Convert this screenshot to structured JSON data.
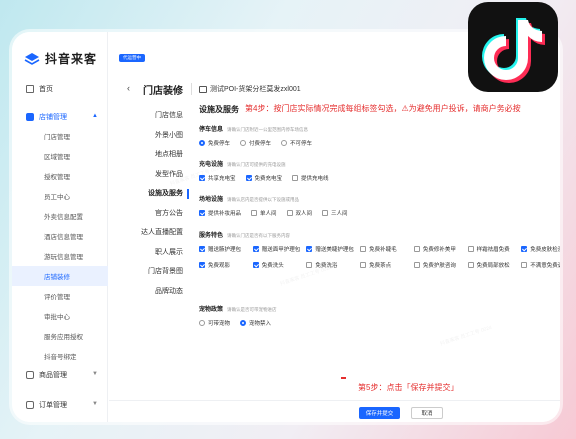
{
  "brand": {
    "name": "抖音来客"
  },
  "sidebar": {
    "home": "首页",
    "store_group": "店铺管理",
    "sub_items": [
      "门店管理",
      "区域管理",
      "授权管理",
      "员工中心",
      "外卖信息配置",
      "酒店信息管理",
      "游玩信息管理",
      "店铺装修",
      "评价管理",
      "审批中心",
      "服务应用授权",
      "抖音号绑定"
    ],
    "active_sub": "店铺装修",
    "product": "商品管理",
    "order": "订单管理"
  },
  "header": {
    "tag": "代运营中",
    "back_icon": "‹",
    "title": "门店装修",
    "store_name": "测试POI-货架分栏莫发zxl001"
  },
  "left_menu": {
    "items": [
      "门店信息",
      "外景小图",
      "地点相册",
      "发型作品",
      "设施及服务",
      "官方公告",
      "达人直播配置",
      "职人展示",
      "门店背景图",
      "品牌动态"
    ],
    "active": "设施及服务"
  },
  "content": {
    "section_title": "设施及服务",
    "step4": "第4步：按门店实际情况完成每组标签勾选，⚠为避免用户投诉，请商户务必按",
    "parking": {
      "label": "停车信息",
      "hint": "请确认门店附近一公里范围内停车场信息",
      "options": [
        "免费停车",
        "付费停车",
        "不可停车"
      ]
    },
    "charging": {
      "label": "充电设施",
      "hint": "请确认门店可提供的充电设施",
      "options": [
        "共享充电宝",
        "免费充电宝",
        "提供充电线"
      ]
    },
    "venue": {
      "label": "场地设施",
      "hint": "请确认店内是否提供以下设施或用品",
      "options": [
        "提供补妆用品",
        "单人间",
        "双人间",
        "三人间"
      ]
    },
    "service": {
      "label": "服务特色",
      "hint": "请确认门店是否有以下服务内容",
      "options": [
        "赠送腋护理包",
        "赠送面甲护理包",
        "赠送美睫护理包",
        "免费补睫毛",
        "免费修补美甲",
        "样霜祛眉免费",
        "免费皮肤检测",
        "免费观影",
        "免费洗头",
        "免费洗浴",
        "免费茶点",
        "免费护肤咨询",
        "免费局部放松",
        "不满意免费调整"
      ]
    },
    "pet": {
      "label": "宠物政策",
      "hint": "请确认是否可带宠物进店",
      "options": [
        "可带宠物",
        "宠物禁入"
      ]
    },
    "step5": "第5步：点击「保存并提交」"
  },
  "footer": {
    "save": "保存并提交",
    "cancel": "取消"
  },
  "watermark": "抖音来客 员工工号 0024",
  "colors": {
    "accent": "#1a66ff",
    "warning": "#e52e2e",
    "logo_cyan": "#25f4ee",
    "logo_pink": "#fe2c55"
  }
}
